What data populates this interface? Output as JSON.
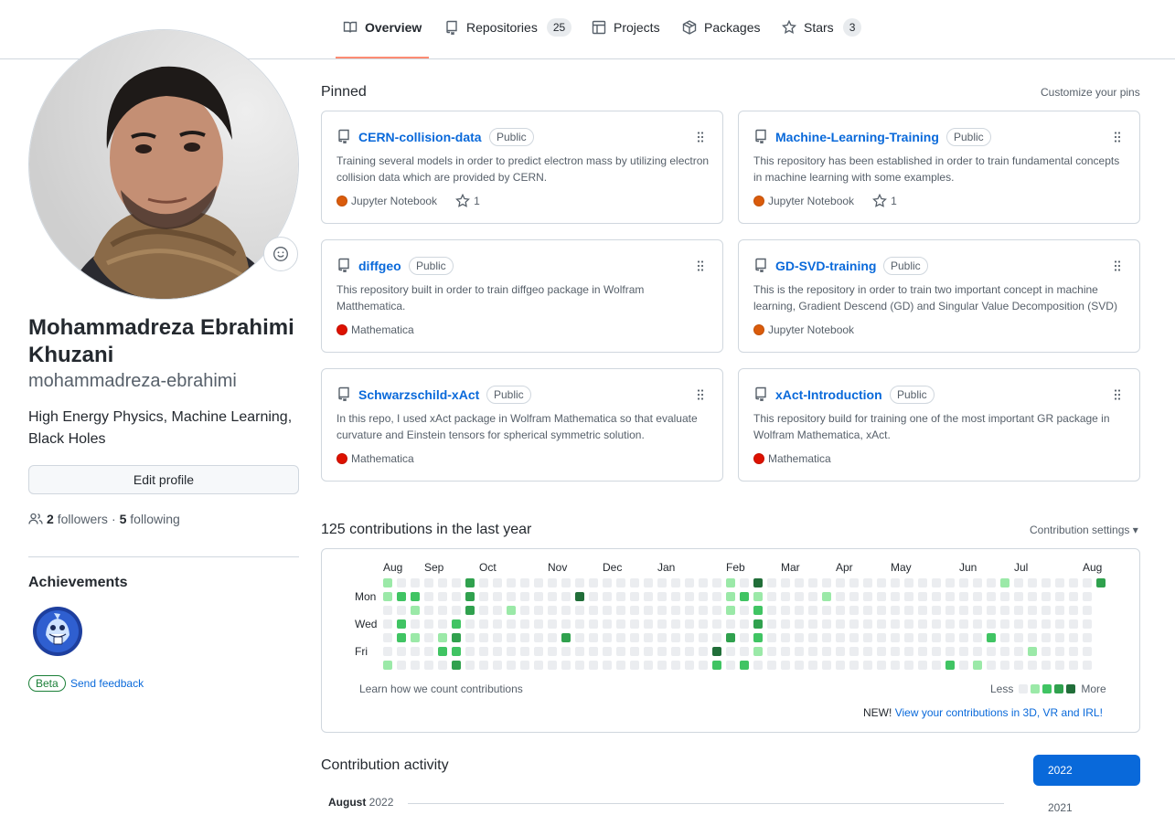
{
  "nav": {
    "tabs": [
      {
        "label": "Overview",
        "icon": "book-icon",
        "active": true
      },
      {
        "label": "Repositories",
        "icon": "repo-icon",
        "count": "25"
      },
      {
        "label": "Projects",
        "icon": "table-icon"
      },
      {
        "label": "Packages",
        "icon": "package-icon"
      },
      {
        "label": "Stars",
        "icon": "star-icon",
        "count": "3"
      }
    ]
  },
  "profile": {
    "fullname": "Mohammadreza Ebrahimi Khuzani",
    "login": "mohammadreza-ebrahimi",
    "bio": "High Energy Physics, Machine Learning, Black Holes",
    "edit_label": "Edit profile",
    "followers_count": "2",
    "followers_label": "followers",
    "separator": "·",
    "following_count": "5",
    "following_label": "following",
    "achievements_title": "Achievements",
    "beta_label": "Beta",
    "feedback_label": "Send feedback"
  },
  "pinned": {
    "title": "Pinned",
    "customize_label": "Customize your pins",
    "repos": [
      {
        "name": "CERN-collision-data",
        "visibility": "Public",
        "description": "Training several models in order to predict electron mass by utilizing electron collision data which are provided by CERN.",
        "language": "Jupyter Notebook",
        "language_color": "#DA5B0B",
        "stars": "1"
      },
      {
        "name": "Machine-Learning-Training",
        "visibility": "Public",
        "description": "This repository has been established in order to train fundamental concepts in machine learning with some examples.",
        "language": "Jupyter Notebook",
        "language_color": "#DA5B0B",
        "stars": "1"
      },
      {
        "name": "diffgeo",
        "visibility": "Public",
        "description": "This repository built in order to train diffgeo package in Wolfram Matthematica.",
        "language": "Mathematica",
        "language_color": "#DD1100",
        "stars": ""
      },
      {
        "name": "GD-SVD-training",
        "visibility": "Public",
        "description": "This is the repository in order to train two important concept in machine learning, Gradient Descend (GD) and Singular Value Decomposition (SVD)",
        "language": "Jupyter Notebook",
        "language_color": "#DA5B0B",
        "stars": ""
      },
      {
        "name": "Schwarzschild-xAct",
        "visibility": "Public",
        "description": "In this repo, I used xAct package in Wolfram Mathematica so that evaluate curvature and Einstein tensors for spherical symmetric solution.",
        "language": "Mathematica",
        "language_color": "#DD1100",
        "stars": ""
      },
      {
        "name": "xAct-Introduction",
        "visibility": "Public",
        "description": "This repository build for training one of the most important GR package in Wolfram Mathematica, xAct.",
        "language": "Mathematica",
        "language_color": "#DD1100",
        "stars": ""
      }
    ]
  },
  "contributions": {
    "title": "125 contributions in the last year",
    "settings_label": "Contribution settings ▾",
    "months": [
      {
        "label": "Aug",
        "week": 0
      },
      {
        "label": "Sep",
        "week": 3
      },
      {
        "label": "Oct",
        "week": 7
      },
      {
        "label": "Nov",
        "week": 12
      },
      {
        "label": "Dec",
        "week": 16
      },
      {
        "label": "Jan",
        "week": 20
      },
      {
        "label": "Feb",
        "week": 25
      },
      {
        "label": "Mar",
        "week": 29
      },
      {
        "label": "Apr",
        "week": 33
      },
      {
        "label": "May",
        "week": 37
      },
      {
        "label": "Jun",
        "week": 42
      },
      {
        "label": "Jul",
        "week": 46
      },
      {
        "label": "Aug",
        "week": 51
      }
    ],
    "day_labels": [
      {
        "label": "Mon",
        "day": 1
      },
      {
        "label": "Wed",
        "day": 3
      },
      {
        "label": "Fri",
        "day": 5
      }
    ],
    "weeks": 53,
    "last_week_days": 1,
    "levels": [
      "#ebedf0",
      "#9be9a8",
      "#40c463",
      "#30a14e",
      "#216e39"
    ],
    "cells": [
      [
        0,
        0,
        1
      ],
      [
        0,
        1,
        1
      ],
      [
        0,
        6,
        1
      ],
      [
        1,
        1,
        2
      ],
      [
        1,
        3,
        2
      ],
      [
        1,
        4,
        2
      ],
      [
        2,
        1,
        2
      ],
      [
        2,
        2,
        1
      ],
      [
        2,
        4,
        1
      ],
      [
        4,
        4,
        1
      ],
      [
        4,
        5,
        2
      ],
      [
        5,
        3,
        2
      ],
      [
        5,
        4,
        3
      ],
      [
        5,
        5,
        2
      ],
      [
        5,
        6,
        3
      ],
      [
        6,
        0,
        3
      ],
      [
        6,
        1,
        3
      ],
      [
        6,
        2,
        3
      ],
      [
        9,
        2,
        1
      ],
      [
        13,
        4,
        3
      ],
      [
        14,
        1,
        4
      ],
      [
        24,
        5,
        4
      ],
      [
        24,
        6,
        2
      ],
      [
        25,
        0,
        1
      ],
      [
        25,
        1,
        1
      ],
      [
        25,
        2,
        1
      ],
      [
        25,
        4,
        3
      ],
      [
        26,
        1,
        2
      ],
      [
        26,
        6,
        2
      ],
      [
        27,
        0,
        4
      ],
      [
        27,
        1,
        1
      ],
      [
        27,
        2,
        2
      ],
      [
        27,
        3,
        3
      ],
      [
        27,
        4,
        2
      ],
      [
        27,
        5,
        1
      ],
      [
        32,
        1,
        1
      ],
      [
        41,
        6,
        2
      ],
      [
        43,
        6,
        1
      ],
      [
        44,
        4,
        2
      ],
      [
        45,
        0,
        1
      ],
      [
        47,
        5,
        1
      ],
      [
        52,
        0,
        3
      ]
    ],
    "learn_label": "Learn how we count contributions",
    "legend_less": "Less",
    "legend_more": "More",
    "new_label": "NEW!",
    "new_link": "View your contributions in 3D, VR and IRL!"
  },
  "activity": {
    "title": "Contribution activity",
    "month": "August",
    "year": "2022",
    "years": [
      "2022",
      "2021"
    ]
  }
}
